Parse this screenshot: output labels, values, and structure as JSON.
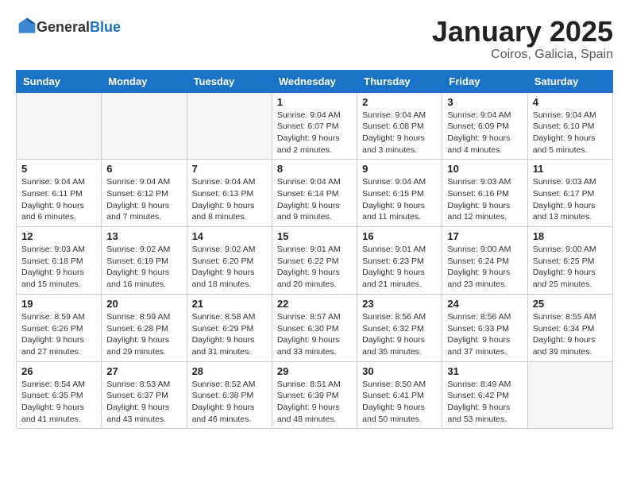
{
  "logo": {
    "general": "General",
    "blue": "Blue"
  },
  "title": "January 2025",
  "location": "Coiros, Galicia, Spain",
  "weekdays": [
    "Sunday",
    "Monday",
    "Tuesday",
    "Wednesday",
    "Thursday",
    "Friday",
    "Saturday"
  ],
  "weeks": [
    [
      {
        "day": "",
        "info": ""
      },
      {
        "day": "",
        "info": ""
      },
      {
        "day": "",
        "info": ""
      },
      {
        "day": "1",
        "info": "Sunrise: 9:04 AM\nSunset: 6:07 PM\nDaylight: 9 hours\nand 2 minutes."
      },
      {
        "day": "2",
        "info": "Sunrise: 9:04 AM\nSunset: 6:08 PM\nDaylight: 9 hours\nand 3 minutes."
      },
      {
        "day": "3",
        "info": "Sunrise: 9:04 AM\nSunset: 6:09 PM\nDaylight: 9 hours\nand 4 minutes."
      },
      {
        "day": "4",
        "info": "Sunrise: 9:04 AM\nSunset: 6:10 PM\nDaylight: 9 hours\nand 5 minutes."
      }
    ],
    [
      {
        "day": "5",
        "info": "Sunrise: 9:04 AM\nSunset: 6:11 PM\nDaylight: 9 hours\nand 6 minutes."
      },
      {
        "day": "6",
        "info": "Sunrise: 9:04 AM\nSunset: 6:12 PM\nDaylight: 9 hours\nand 7 minutes."
      },
      {
        "day": "7",
        "info": "Sunrise: 9:04 AM\nSunset: 6:13 PM\nDaylight: 9 hours\nand 8 minutes."
      },
      {
        "day": "8",
        "info": "Sunrise: 9:04 AM\nSunset: 6:14 PM\nDaylight: 9 hours\nand 9 minutes."
      },
      {
        "day": "9",
        "info": "Sunrise: 9:04 AM\nSunset: 6:15 PM\nDaylight: 9 hours\nand 11 minutes."
      },
      {
        "day": "10",
        "info": "Sunrise: 9:03 AM\nSunset: 6:16 PM\nDaylight: 9 hours\nand 12 minutes."
      },
      {
        "day": "11",
        "info": "Sunrise: 9:03 AM\nSunset: 6:17 PM\nDaylight: 9 hours\nand 13 minutes."
      }
    ],
    [
      {
        "day": "12",
        "info": "Sunrise: 9:03 AM\nSunset: 6:18 PM\nDaylight: 9 hours\nand 15 minutes."
      },
      {
        "day": "13",
        "info": "Sunrise: 9:02 AM\nSunset: 6:19 PM\nDaylight: 9 hours\nand 16 minutes."
      },
      {
        "day": "14",
        "info": "Sunrise: 9:02 AM\nSunset: 6:20 PM\nDaylight: 9 hours\nand 18 minutes."
      },
      {
        "day": "15",
        "info": "Sunrise: 9:01 AM\nSunset: 6:22 PM\nDaylight: 9 hours\nand 20 minutes."
      },
      {
        "day": "16",
        "info": "Sunrise: 9:01 AM\nSunset: 6:23 PM\nDaylight: 9 hours\nand 21 minutes."
      },
      {
        "day": "17",
        "info": "Sunrise: 9:00 AM\nSunset: 6:24 PM\nDaylight: 9 hours\nand 23 minutes."
      },
      {
        "day": "18",
        "info": "Sunrise: 9:00 AM\nSunset: 6:25 PM\nDaylight: 9 hours\nand 25 minutes."
      }
    ],
    [
      {
        "day": "19",
        "info": "Sunrise: 8:59 AM\nSunset: 6:26 PM\nDaylight: 9 hours\nand 27 minutes."
      },
      {
        "day": "20",
        "info": "Sunrise: 8:59 AM\nSunset: 6:28 PM\nDaylight: 9 hours\nand 29 minutes."
      },
      {
        "day": "21",
        "info": "Sunrise: 8:58 AM\nSunset: 6:29 PM\nDaylight: 9 hours\nand 31 minutes."
      },
      {
        "day": "22",
        "info": "Sunrise: 8:57 AM\nSunset: 6:30 PM\nDaylight: 9 hours\nand 33 minutes."
      },
      {
        "day": "23",
        "info": "Sunrise: 8:56 AM\nSunset: 6:32 PM\nDaylight: 9 hours\nand 35 minutes."
      },
      {
        "day": "24",
        "info": "Sunrise: 8:56 AM\nSunset: 6:33 PM\nDaylight: 9 hours\nand 37 minutes."
      },
      {
        "day": "25",
        "info": "Sunrise: 8:55 AM\nSunset: 6:34 PM\nDaylight: 9 hours\nand 39 minutes."
      }
    ],
    [
      {
        "day": "26",
        "info": "Sunrise: 8:54 AM\nSunset: 6:35 PM\nDaylight: 9 hours\nand 41 minutes."
      },
      {
        "day": "27",
        "info": "Sunrise: 8:53 AM\nSunset: 6:37 PM\nDaylight: 9 hours\nand 43 minutes."
      },
      {
        "day": "28",
        "info": "Sunrise: 8:52 AM\nSunset: 6:38 PM\nDaylight: 9 hours\nand 46 minutes."
      },
      {
        "day": "29",
        "info": "Sunrise: 8:51 AM\nSunset: 6:39 PM\nDaylight: 9 hours\nand 48 minutes."
      },
      {
        "day": "30",
        "info": "Sunrise: 8:50 AM\nSunset: 6:41 PM\nDaylight: 9 hours\nand 50 minutes."
      },
      {
        "day": "31",
        "info": "Sunrise: 8:49 AM\nSunset: 6:42 PM\nDaylight: 9 hours\nand 53 minutes."
      },
      {
        "day": "",
        "info": ""
      }
    ]
  ]
}
